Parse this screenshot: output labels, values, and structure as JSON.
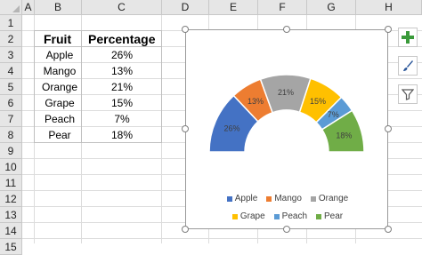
{
  "columns": [
    "A",
    "B",
    "C",
    "D",
    "E",
    "F",
    "G",
    "H"
  ],
  "rows": [
    "1",
    "2",
    "3",
    "4",
    "5",
    "6",
    "7",
    "8",
    "9",
    "10",
    "11",
    "12",
    "13",
    "14",
    "15"
  ],
  "table": {
    "headers": [
      "Fruit",
      "Percentage"
    ],
    "rows": [
      [
        "Apple",
        "26%"
      ],
      [
        "Mango",
        "13%"
      ],
      [
        "Orange",
        "21%"
      ],
      [
        "Grape",
        "15%"
      ],
      [
        "Peach",
        "7%"
      ],
      [
        "Pear",
        "18%"
      ]
    ]
  },
  "chart_data": {
    "type": "pie",
    "variant": "half-doughnut",
    "categories": [
      "Apple",
      "Mango",
      "Orange",
      "Grape",
      "Peach",
      "Pear"
    ],
    "values": [
      26,
      13,
      21,
      15,
      7,
      18
    ],
    "data_labels": [
      "26%",
      "13%",
      "21%",
      "15%",
      "7%",
      "18%"
    ],
    "colors": [
      "#4472c4",
      "#ed7d31",
      "#a5a5a5",
      "#ffc000",
      "#5b9bd5",
      "#70ad47"
    ],
    "legend_position": "bottom",
    "title": ""
  },
  "side_buttons": {
    "elements": "chart-elements",
    "styles": "chart-styles",
    "filters": "chart-filters"
  }
}
